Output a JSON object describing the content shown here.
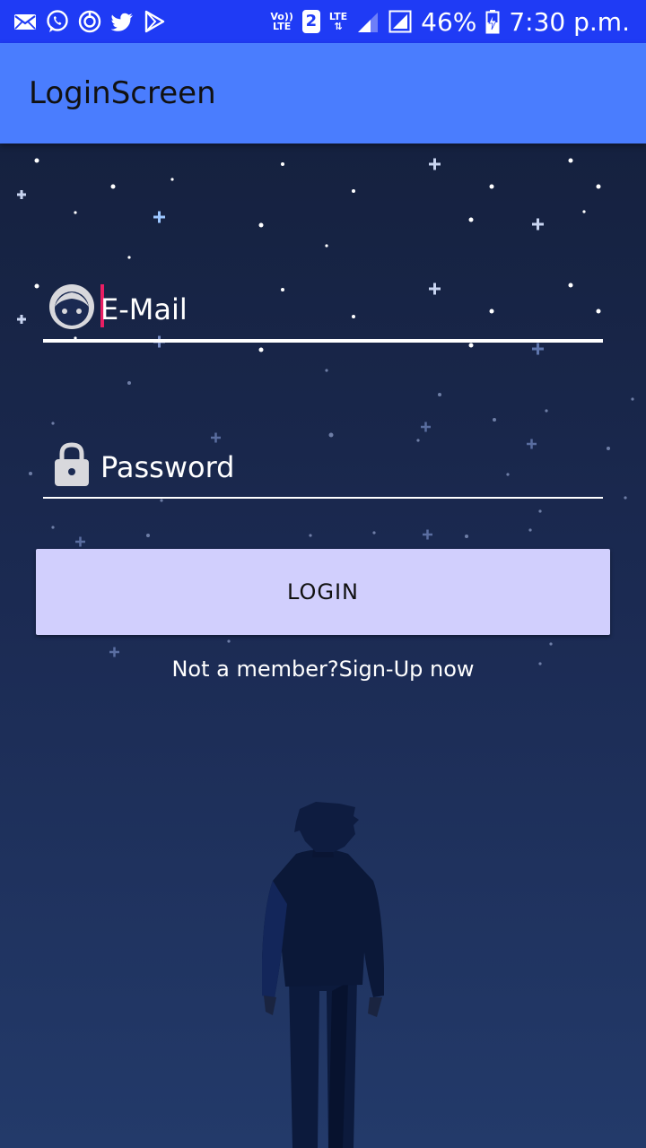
{
  "status_bar": {
    "left_icons": [
      "mail-icon",
      "whatsapp-icon",
      "sync-icon",
      "twitter-icon",
      "play-store-icon"
    ],
    "volte_line1": "Vo))",
    "volte_line2": "LTE",
    "sim_number": "2",
    "lte_label": "LTE",
    "battery_percent": "46%",
    "time": "7:30 p.m."
  },
  "app_bar": {
    "title": "LoginScreen"
  },
  "form": {
    "email": {
      "placeholder": "E-Mail",
      "icon": "face-icon"
    },
    "password": {
      "placeholder": "Password",
      "icon": "lock-icon"
    },
    "login_label": "LOGIN",
    "signup_text": "Not a member?Sign-Up now"
  },
  "colors": {
    "status_bar": "#1f3bf5",
    "app_bar": "#4a7dfe",
    "background_top": "#15213f",
    "background_bottom": "#233a6a",
    "button": "#d1cffd",
    "cursor": "#e91e63"
  }
}
